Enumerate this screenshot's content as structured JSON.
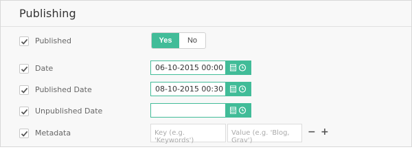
{
  "panel": {
    "title": "Publishing"
  },
  "published": {
    "label": "Published",
    "yes": "Yes",
    "no": "No",
    "selected": "Yes"
  },
  "date": {
    "label": "Date",
    "value": "06-10-2015 00:00"
  },
  "published_date": {
    "label": "Published Date",
    "value": "08-10-2015 00:30"
  },
  "unpublished_date": {
    "label": "Unpublished Date",
    "value": ""
  },
  "metadata": {
    "label": "Metadata",
    "key_placeholder": "Key (e.g. 'Keywords')",
    "value_placeholder": "Value (e.g. 'Blog, Grav')",
    "remove": "−",
    "add": "+"
  },
  "colors": {
    "accent": "#41bc98",
    "border": "#d8d8d8"
  },
  "icons": {
    "checkbox": "check-icon",
    "calendar": "calendar-icon",
    "clock": "clock-icon"
  }
}
